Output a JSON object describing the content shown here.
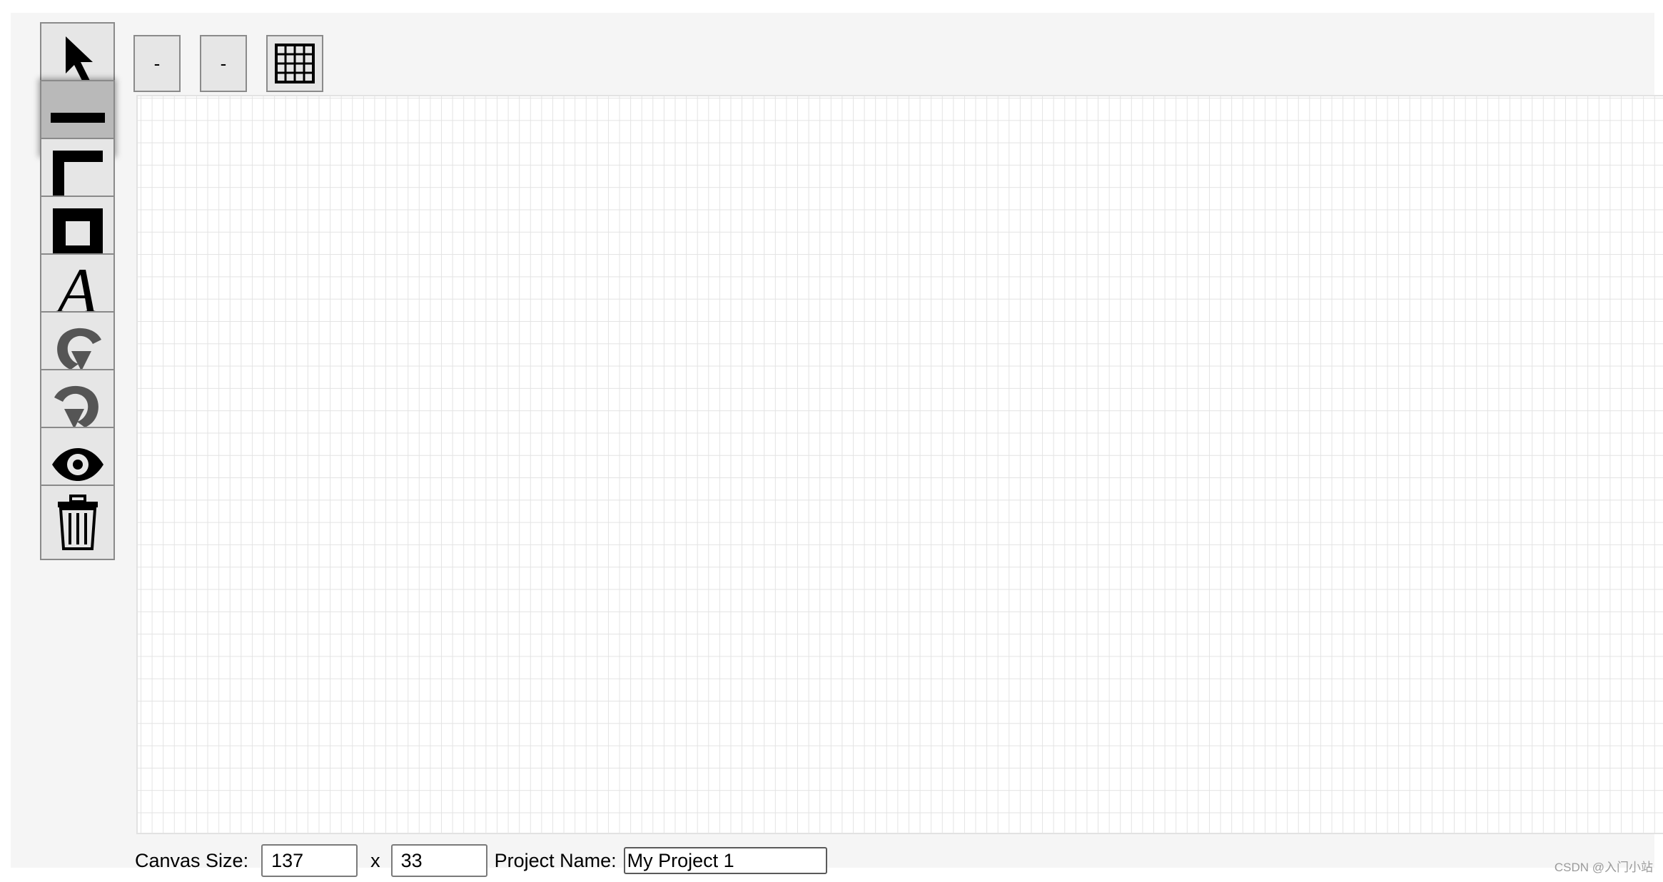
{
  "toolbar_left": {
    "tools": [
      {
        "name": "select",
        "icon": "cursor-arrow-icon"
      },
      {
        "name": "line",
        "icon": "horizontal-line-icon",
        "active": true
      },
      {
        "name": "corner",
        "icon": "corner-line-icon"
      },
      {
        "name": "box",
        "icon": "box-square-icon"
      },
      {
        "name": "text",
        "icon": "text-a-icon",
        "glyph": "A"
      },
      {
        "name": "undo",
        "icon": "undo-arrow-icon"
      },
      {
        "name": "redo",
        "icon": "redo-arrow-icon"
      },
      {
        "name": "preview",
        "icon": "eye-icon"
      },
      {
        "name": "delete",
        "icon": "trash-icon"
      }
    ]
  },
  "toolbar_top": {
    "button1_label": "-",
    "button2_label": "-",
    "grid_icon": "grid-icon"
  },
  "canvas": {
    "columns": 137,
    "rows": 33,
    "grid_color": "#e3e3e3"
  },
  "footer": {
    "canvas_size_label": "Canvas Size:",
    "width_value": "137",
    "times_label": "x",
    "height_value": "33",
    "project_name_label": "Project Name:",
    "project_name_value": "My Project 1"
  },
  "watermark": "CSDN @入门小站"
}
